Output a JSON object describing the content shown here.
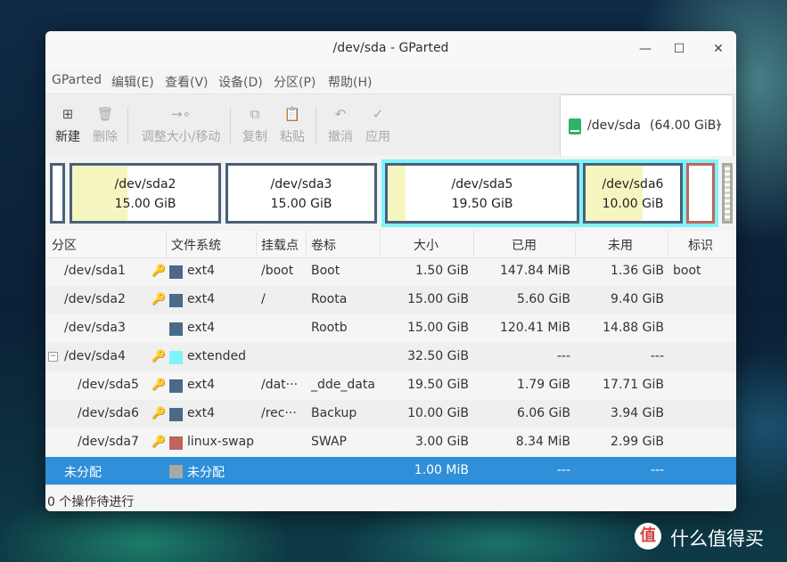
{
  "window": {
    "title": "/dev/sda - GParted"
  },
  "menu": [
    "GParted",
    "编辑(E)",
    "查看(V)",
    "设备(D)",
    "分区(P)",
    "帮助(H)"
  ],
  "toolbar": {
    "new": "新建",
    "delete": "删除",
    "resize": "调整大小/移动",
    "copy": "复制",
    "paste": "粘贴",
    "undo": "撤消",
    "apply": "应用"
  },
  "device": {
    "name": "/dev/sda",
    "size": "(64.00 GiB)"
  },
  "diskmap": [
    {
      "name": "/dev/sda2",
      "size": "15.00 GiB"
    },
    {
      "name": "/dev/sda3",
      "size": "15.00 GiB"
    },
    {
      "name": "/dev/sda5",
      "size": "19.50 GiB"
    },
    {
      "name": "/dev/sda6",
      "size": "10.00 GiB"
    }
  ],
  "columns": [
    "分区",
    "文件系统",
    "挂载点",
    "卷标",
    "大小",
    "已用",
    "未用",
    "标识"
  ],
  "rows": [
    {
      "partition": "/dev/sda1",
      "fs": "ext4",
      "mount": "/boot",
      "label": "Boot",
      "size": "1.50 GiB",
      "used": "147.84 MiB",
      "unused": "1.36 GiB",
      "flags": "boot"
    },
    {
      "partition": "/dev/sda2",
      "fs": "ext4",
      "mount": "/",
      "label": "Roota",
      "size": "15.00 GiB",
      "used": "5.60 GiB",
      "unused": "9.40 GiB",
      "flags": ""
    },
    {
      "partition": "/dev/sda3",
      "fs": "ext4",
      "mount": "",
      "label": "Rootb",
      "size": "15.00 GiB",
      "used": "120.41 MiB",
      "unused": "14.88 GiB",
      "flags": ""
    },
    {
      "partition": "/dev/sda4",
      "fs": "extended",
      "mount": "",
      "label": "",
      "size": "32.50 GiB",
      "used": "---",
      "unused": "---",
      "flags": ""
    },
    {
      "partition": "/dev/sda5",
      "fs": "ext4",
      "mount": "/dat···",
      "label": "_dde_data",
      "size": "19.50 GiB",
      "used": "1.79 GiB",
      "unused": "17.71 GiB",
      "flags": ""
    },
    {
      "partition": "/dev/sda6",
      "fs": "ext4",
      "mount": "/rec···",
      "label": "Backup",
      "size": "10.00 GiB",
      "used": "6.06 GiB",
      "unused": "3.94 GiB",
      "flags": ""
    },
    {
      "partition": "/dev/sda7",
      "fs": "linux-swap",
      "mount": "",
      "label": "SWAP",
      "size": "3.00 GiB",
      "used": "8.34 MiB",
      "unused": "2.99 GiB",
      "flags": ""
    },
    {
      "partition": "未分配",
      "fs": "未分配",
      "mount": "",
      "label": "",
      "size": "1.00 MiB",
      "used": "---",
      "unused": "---",
      "flags": ""
    }
  ],
  "colors": {
    "ext4": "#4a6a88",
    "extended": "#7ef3fb",
    "swap": "#c0645c",
    "unallocated": "#a8a8a8",
    "selection": "#2f8fd8"
  },
  "status": "0 个操作待进行",
  "watermark": {
    "icon": "值",
    "text": "什么值得买"
  }
}
